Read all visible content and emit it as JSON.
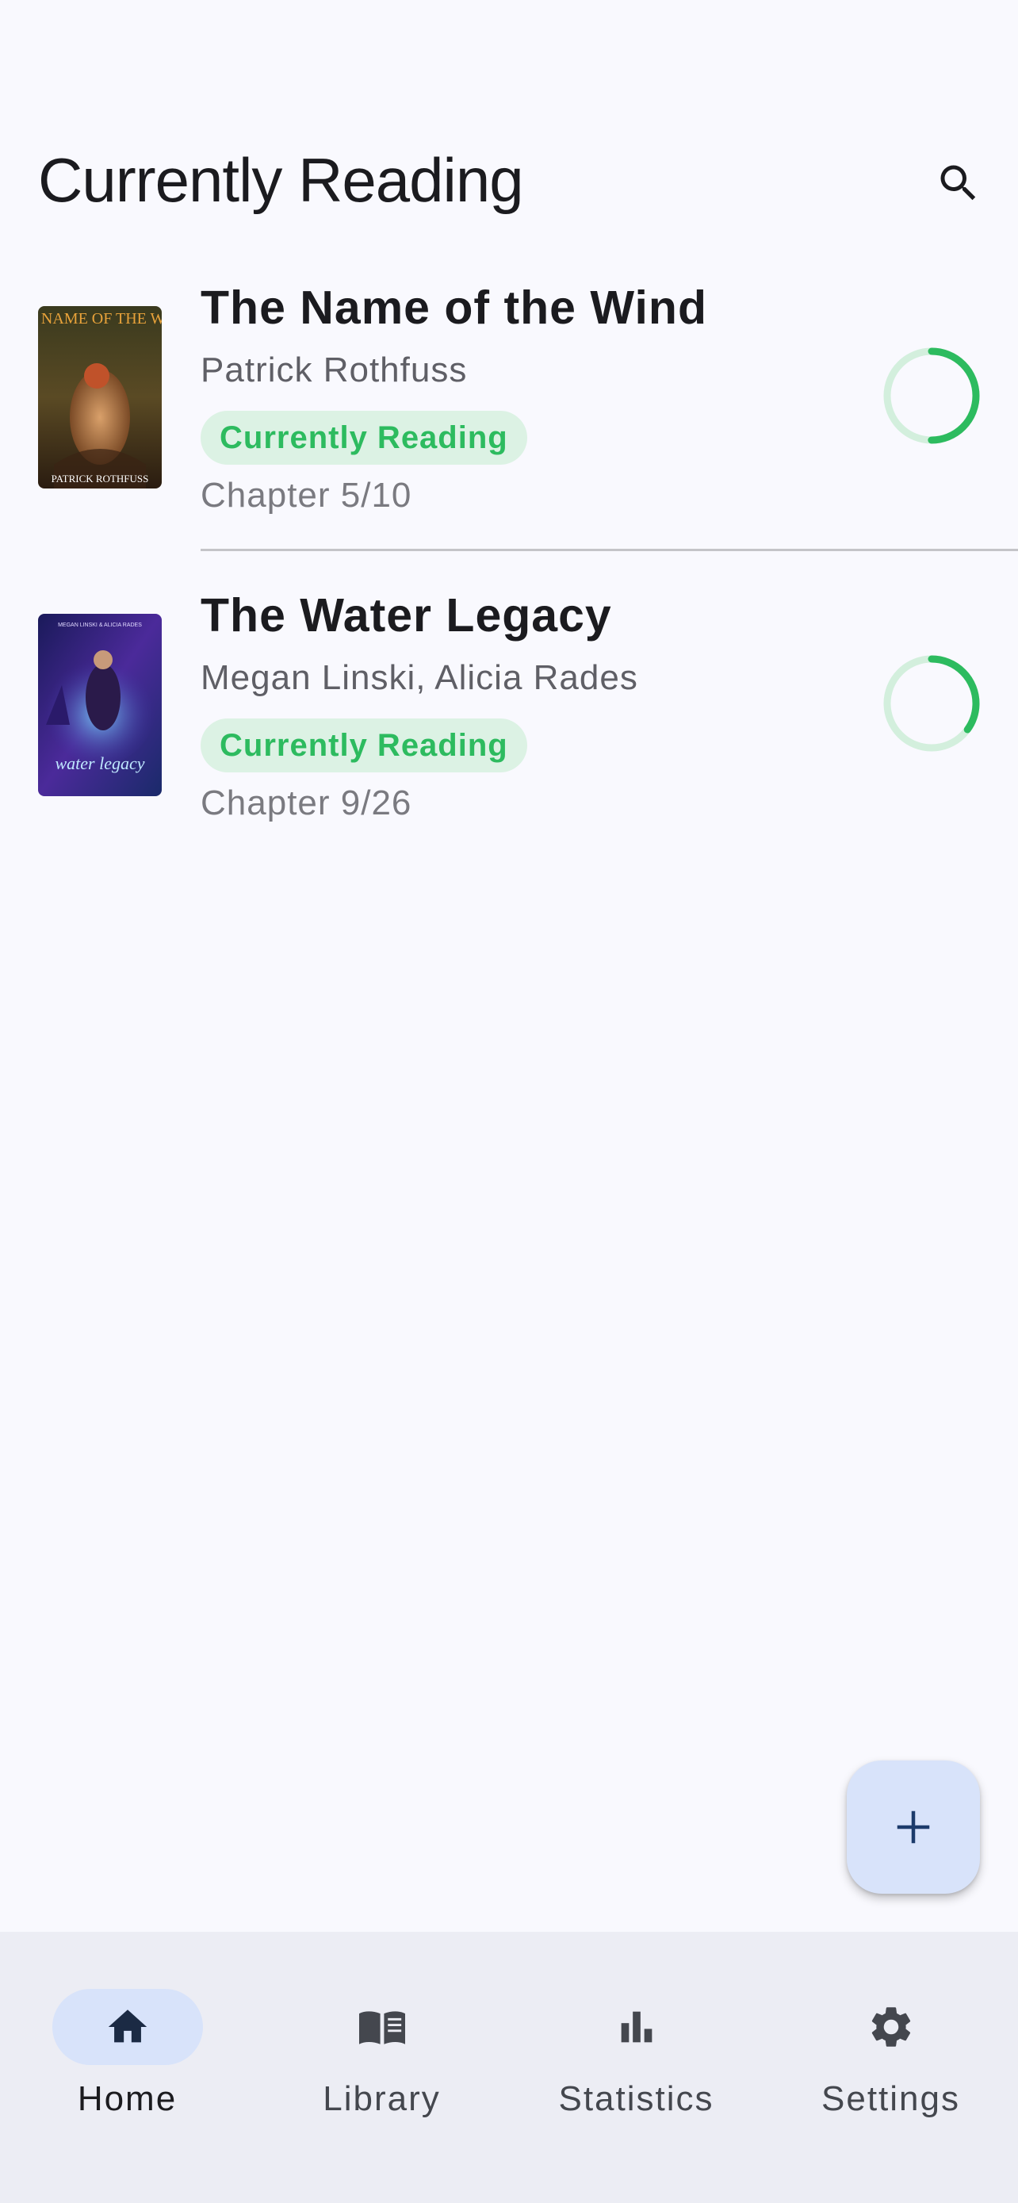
{
  "header": {
    "title": "Currently Reading",
    "search_icon": "search-icon"
  },
  "books": [
    {
      "title": "The Name of the Wind",
      "author": "Patrick Rothfuss",
      "status": "Currently Reading",
      "progress_text": "Chapter 5/10",
      "progress": 0.5,
      "cover_text_top": "THE NAME OF THE WIND",
      "cover_text_bottom": "PATRICK ROTHFUSS"
    },
    {
      "title": "The Water Legacy",
      "author": "Megan Linski, Alicia Rades",
      "status": "Currently Reading",
      "progress_text": "Chapter 9/26",
      "progress": 0.35,
      "cover_text_top": "MEGAN LINSKI & ALICIA RADES",
      "cover_text_bottom": "water legacy"
    }
  ],
  "fab": {
    "icon": "plus-icon"
  },
  "nav": {
    "items": [
      {
        "label": "Home",
        "icon": "home-icon",
        "active": true
      },
      {
        "label": "Library",
        "icon": "library-icon",
        "active": false
      },
      {
        "label": "Statistics",
        "icon": "statistics-icon",
        "active": false
      },
      {
        "label": "Settings",
        "icon": "settings-icon",
        "active": false
      }
    ]
  },
  "colors": {
    "accent_green": "#2dbb5f",
    "badge_bg": "#dcf2e4",
    "nav_active_bg": "#d8e3fa",
    "nav_bg": "#ecedf4",
    "background": "#f9f9fe"
  }
}
